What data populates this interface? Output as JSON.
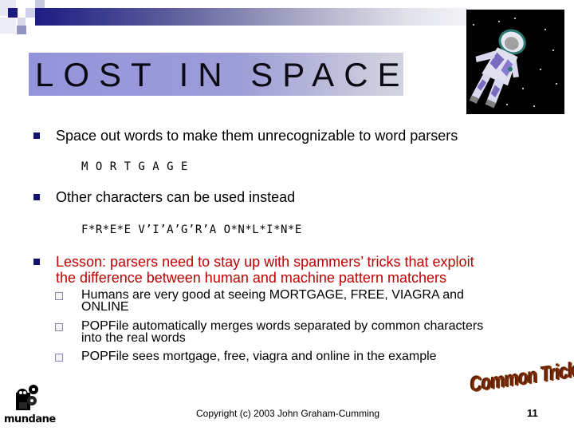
{
  "slide": {
    "title": "LOST IN SPACE",
    "bullets": [
      {
        "text": "Space out words to make them unrecognizable to word parsers",
        "example": "M O R T G A G E"
      },
      {
        "text": "Other characters can be used instead",
        "example": "F*R*E*E V’I’A’G’R’A O*N*L*I*N*E"
      },
      {
        "text_line1": "Lesson: parsers need to stay up with spammers’ tricks that exploit",
        "text_line2": "the difference between human and machine pattern matchers",
        "color": "#c00000",
        "sub_bullets": [
          {
            "line1": "Humans are very good at seeing MORTGAGE, FREE, VIAGRA and",
            "line2": "ONLINE"
          },
          {
            "line1": "POPFile automatically merges words separated by common characters",
            "line2": "into the real words"
          },
          {
            "line1": "POPFile sees mortgage, free, viagra and online in the example"
          }
        ]
      }
    ],
    "badge": "Common Trick",
    "footer": {
      "copyright": "Copyright (c) 2003 John Graham-Cumming",
      "page_number": "11",
      "logo_text": "mundane"
    },
    "images": {
      "astronaut": "astronaut-in-space-image",
      "logo": "mundane-logo-image"
    },
    "colors": {
      "title_bar_start": "#1c1c84",
      "bullet": "#141470",
      "lesson_text": "#c00000",
      "title_box": "#9494dc"
    }
  }
}
